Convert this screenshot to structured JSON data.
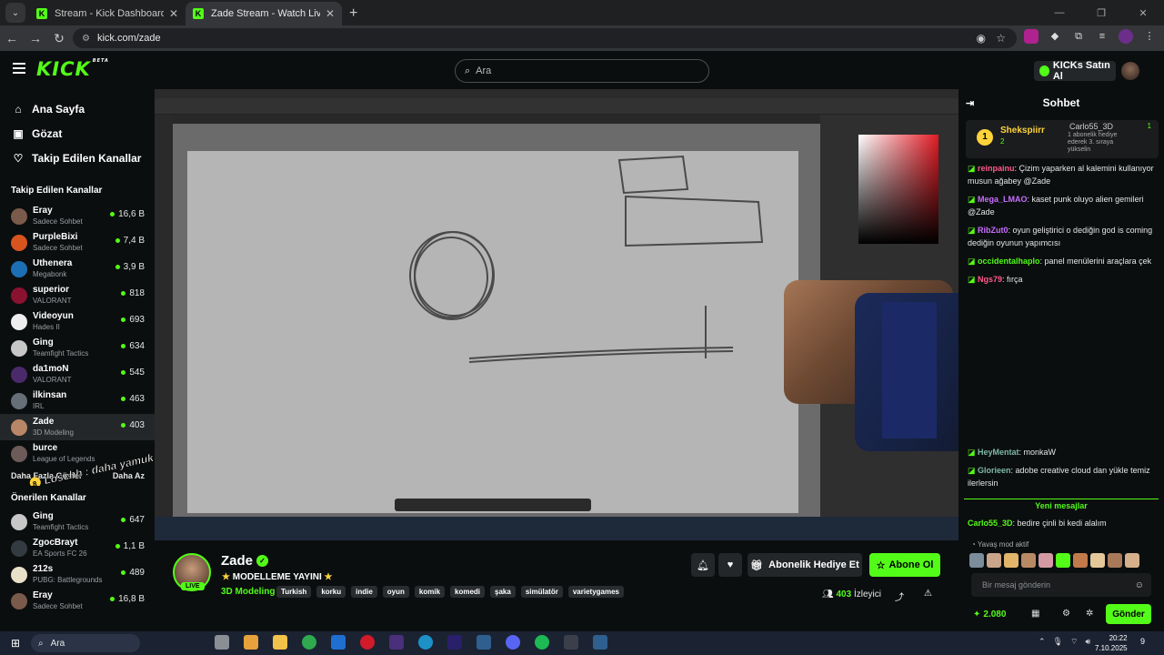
{
  "browser": {
    "tabs": [
      {
        "title": "Stream - Kick Dashboard",
        "active": false
      },
      {
        "title": "Zade Stream - Watch Live on Ki",
        "active": true
      }
    ],
    "url": "kick.com/zade"
  },
  "header": {
    "logo": "KICK",
    "logo_tag": "BETA",
    "search_placeholder": "Ara",
    "buy_kicks": "KICKs Satın Al"
  },
  "sidebar": {
    "nav": [
      {
        "label": "Ana Sayfa",
        "icon": "home-icon"
      },
      {
        "label": "Gözat",
        "icon": "browse-icon"
      },
      {
        "label": "Takip Edilen Kanallar",
        "icon": "heart-icon"
      }
    ],
    "followed_title": "Takip Edilen Kanallar",
    "followed": [
      {
        "name": "Eray",
        "game": "Sadece Sohbet",
        "viewers": "16,6 B",
        "color": "#7a5a4a"
      },
      {
        "name": "PurpleBixi",
        "game": "Sadece Sohbet",
        "viewers": "7,4 B",
        "color": "#d8541f"
      },
      {
        "name": "Uthenera",
        "game": "Megabonk",
        "viewers": "3,9 B",
        "color": "#1c6fb5"
      },
      {
        "name": "superior",
        "game": "VALORANT",
        "viewers": "818",
        "color": "#8a1230"
      },
      {
        "name": "Videoyun",
        "game": "Hades II",
        "viewers": "693",
        "color": "#eeeeee"
      },
      {
        "name": "Ging",
        "game": "Teamfight Tactics",
        "viewers": "634",
        "color": "#c7c7c7"
      },
      {
        "name": "da1moN",
        "game": "VALORANT",
        "viewers": "545",
        "color": "#4b2a6b"
      },
      {
        "name": "ilkinsan",
        "game": "IRL",
        "viewers": "463",
        "color": "#666f77"
      },
      {
        "name": "Zade",
        "game": "3D Modeling",
        "viewers": "403",
        "color": "#b98767"
      },
      {
        "name": "burce",
        "game": "League of Legends",
        "viewers": "",
        "color": "#6d5b59"
      }
    ],
    "more_left": "Daha Fazla Göster",
    "more_right": "Daha Az",
    "recommended_title": "Önerilen Kanallar",
    "recommended": [
      {
        "name": "Ging",
        "game": "Teamfight Tactics",
        "viewers": "647",
        "color": "#c7c7c7"
      },
      {
        "name": "ZgocBrayt",
        "game": "EA Sports FC 26",
        "viewers": "1,1 B",
        "color": "#333a40"
      },
      {
        "name": "212s",
        "game": "PUBG: Battlegrounds",
        "viewers": "489",
        "color": "#e8e0c8"
      },
      {
        "name": "Eray",
        "game": "Sadece Sohbet",
        "viewers": "16,8 B",
        "color": "#7a5a4a"
      }
    ]
  },
  "overlay": {
    "chat_text": "Loschh : daha yamuk",
    "chat_badge": "8"
  },
  "stream": {
    "name": "Zade",
    "live": "LIVE",
    "title": "MODELLEME YAYINI",
    "category": "3D Modeling",
    "tags": [
      "Turkish",
      "korku",
      "indie",
      "oyun",
      "komik",
      "komedi",
      "şaka",
      "simülatör",
      "varietygames"
    ],
    "gift_label": "Abonelik Hediye Et",
    "subscribe_label": "Abone Ol",
    "viewers": "403",
    "viewers_label": "İzleyici"
  },
  "chat": {
    "title": "Sohbet",
    "pinned": {
      "rank": "1",
      "name": "Shekspiirr",
      "count": "2",
      "second_name": "Carlo55_3D",
      "second_count": "1",
      "desc": "1 abonelik hediye ederek 3. sıraya yükselin"
    },
    "messages": [
      {
        "user": "reinpainu",
        "text": "Çizim yaparken al kalemini kullanıyor musun ağabey @Zade",
        "color": "#ff5a8a"
      },
      {
        "user": "Mega_LMAO",
        "text": "kaset punk oluyo alien gemileri @Zade",
        "color": "#c86dff"
      },
      {
        "user": "RibZut0",
        "text": "oyun geliştirici o dediğin god is coming dediğin oyunun yapımcısı",
        "color": "#c86dff"
      },
      {
        "user": "occidentalhaplo",
        "text": "panel menülerini araçlara çek",
        "color": "#53fc18"
      },
      {
        "user": "Ngs79",
        "text": "fırça",
        "color": "#ff5a8a"
      }
    ],
    "lower_messages": [
      {
        "user": "HeyMentat",
        "text": "monkaW",
        "color": "#7fb8a6"
      },
      {
        "user": "Glorieen",
        "text": "adobe creative cloud dan yükle temiz ilerlersin",
        "color": "#7fb8a6"
      }
    ],
    "new_messages": "Yeni mesajlar",
    "last_message": {
      "user": "Carlo55_3D",
      "text": "bedire çinli bi kedi alalım",
      "color": "#53fc18"
    },
    "slow_mode": "Yavaş mod aktif",
    "input_placeholder": "Bir mesaj gönderin",
    "points": "2.080",
    "send_label": "Gönder"
  },
  "taskbar": {
    "search": "Ara",
    "time": "20:22",
    "date": "7.10.2025",
    "notif_count": "9"
  }
}
